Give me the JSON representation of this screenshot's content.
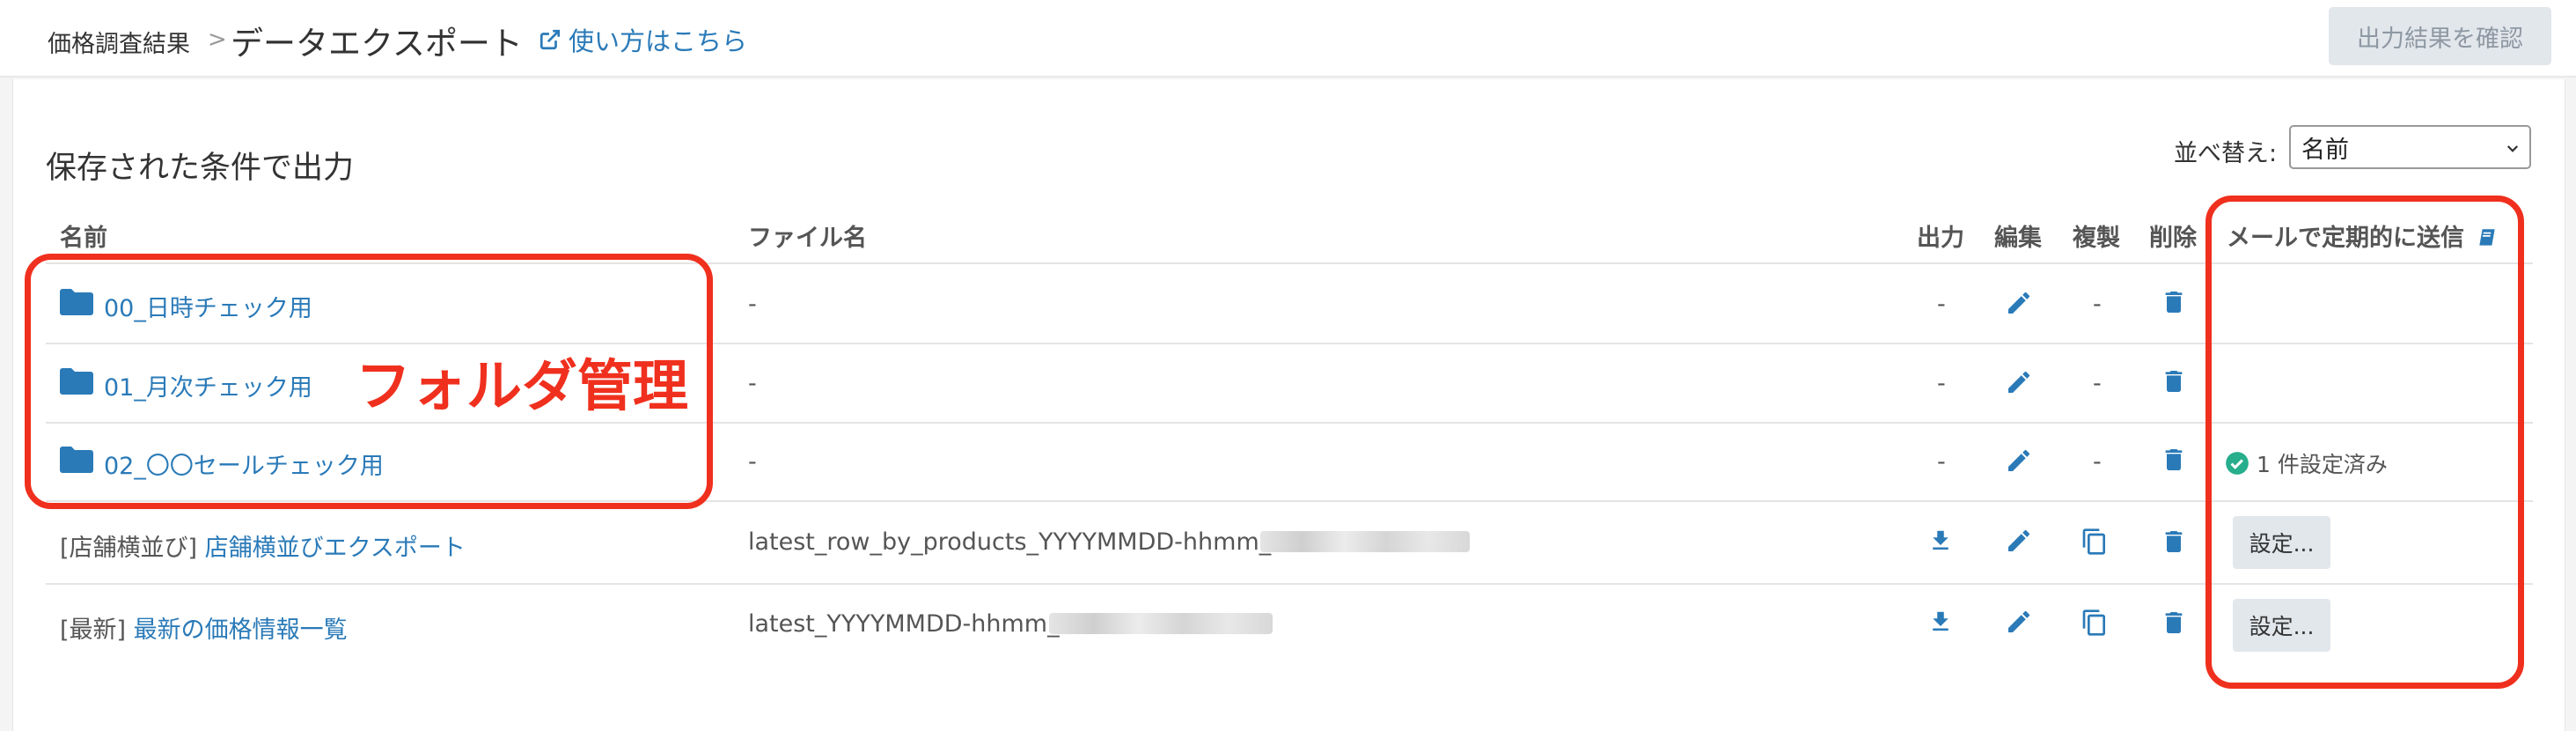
{
  "breadcrumb": {
    "parent": "価格調査結果",
    "separator": ">",
    "current": "データエクスポート"
  },
  "help_link": "使い方はこちら",
  "header_button": "出力結果を確認",
  "section_title": "保存された条件で出力",
  "sort": {
    "label": "並べ替え:",
    "value": "名前"
  },
  "columns": {
    "name": "名前",
    "filename": "ファイル名",
    "output": "出力",
    "edit": "編集",
    "copy": "複製",
    "delete": "削除",
    "mail": "メールで定期的に送信"
  },
  "rows": [
    {
      "name": "00_日時チェック用",
      "filename": "-",
      "output": "-",
      "copy": "-",
      "mail": ""
    },
    {
      "name": "01_月次チェック用",
      "filename": "-",
      "output": "-",
      "copy": "-",
      "mail": ""
    },
    {
      "name": "02_〇〇セールチェック用",
      "filename": "-",
      "output": "-",
      "copy": "-",
      "mail": "1 件設定済み"
    },
    {
      "prefix": "[店舗横並び]",
      "name": "店舗横並びエクスポート",
      "filename": "latest_row_by_products_YYYYMMDD-hhmm_",
      "mail_button": "設定..."
    },
    {
      "prefix": "[最新]",
      "name": "最新の価格情報一覧",
      "filename": "latest_YYYYMMDD-hhmm_",
      "mail_button": "設定..."
    }
  ],
  "annotation": "フォルダ管理",
  "colors": {
    "link": "#2a7ab8",
    "annotation": "#f0301e",
    "success": "#27ae8c",
    "button_bg": "#e2e7ec"
  }
}
